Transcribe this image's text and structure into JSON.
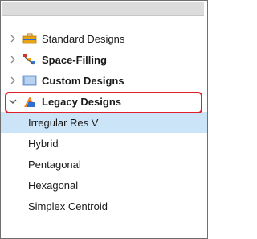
{
  "tree": {
    "parents": [
      {
        "label": "Standard Designs",
        "expanded": false,
        "icon": "toolbox-icon"
      },
      {
        "label": "Space-Filling",
        "expanded": false,
        "icon": "space-filling-icon"
      },
      {
        "label": "Custom Designs",
        "expanded": false,
        "icon": "custom-design-icon"
      },
      {
        "label": "Legacy Designs",
        "expanded": true,
        "icon": "legacy-design-icon"
      }
    ],
    "children": [
      {
        "label": "Irregular Res V",
        "selected": true
      },
      {
        "label": "Hybrid",
        "selected": false
      },
      {
        "label": "Pentagonal",
        "selected": false
      },
      {
        "label": "Hexagonal",
        "selected": false
      },
      {
        "label": "Simplex Centroid",
        "selected": false
      }
    ]
  },
  "colors": {
    "selection": "#cce4f7",
    "highlight_border": "#e0202a"
  }
}
